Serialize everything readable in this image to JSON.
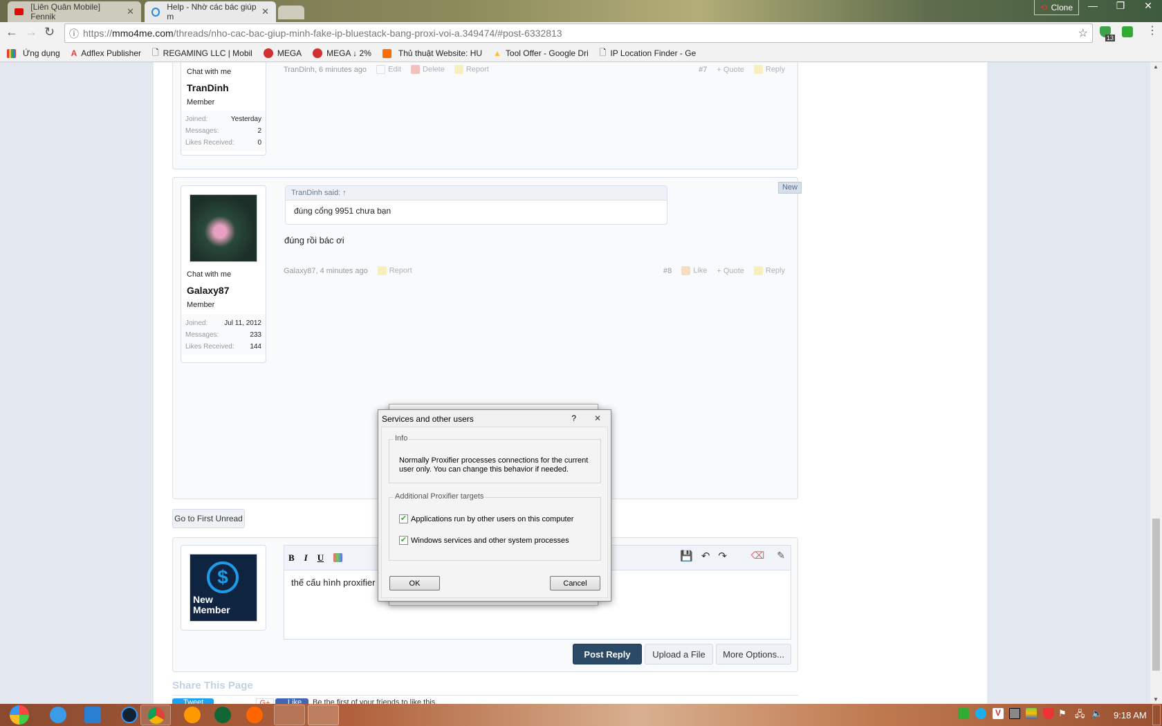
{
  "browser": {
    "tabs": [
      {
        "label": "[Liên Quân Mobile] Fennik",
        "icon": "youtube-icon",
        "active": false
      },
      {
        "label": "Help - Nhờ các bác giúp m",
        "icon": "site-dollar-icon",
        "active": true
      }
    ],
    "profile_label": "Clone",
    "url_host": "mmo4me.com",
    "url_scheme": "https://",
    "url_path": "/threads/nho-cac-bac-giup-minh-fake-ip-bluestack-bang-proxi-voi-a.349474/#post-6332813",
    "extension_badge": "13",
    "bookmarks": [
      {
        "label": "Ứng dụng",
        "color": "#e53935"
      },
      {
        "label": "Adflex Publisher",
        "color": "#e53935"
      },
      {
        "label": "REGAMING LLC | Mobil",
        "color": "#999999"
      },
      {
        "label": "MEGA",
        "color": "#d32f2f"
      },
      {
        "label": "MEGA ↓ 2%",
        "color": "#d32f2f"
      },
      {
        "label": "Thủ thuật Website: HU",
        "color": "#ff6d00"
      },
      {
        "label": "Tool Offer - Google Dri",
        "color": "#2e7d32"
      },
      {
        "label": "IP Location Finder - Ge",
        "color": "#999999"
      }
    ]
  },
  "posts": [
    {
      "chat": "Chat with me",
      "username": "TranDinh",
      "role": "Member",
      "stats": [
        [
          "Joined:",
          "Yesterday"
        ],
        [
          "Messages:",
          "2"
        ],
        [
          "Likes Received:",
          "0"
        ]
      ],
      "author_time": "TranDinh, 6 minutes ago",
      "actions": [
        "Edit",
        "Delete",
        "Report"
      ],
      "number": "#7",
      "right_actions": [
        "+ Quote",
        "Reply"
      ]
    },
    {
      "chat": "Chat with me",
      "username": "Galaxy87",
      "role": "Member",
      "stats": [
        [
          "Joined:",
          "Jul 11, 2012"
        ],
        [
          "Messages:",
          "233"
        ],
        [
          "Likes Received:",
          "144"
        ]
      ],
      "quote_header": "TranDinh said: ↑",
      "quote_text": "đúng cổng 9951 chưa bạn",
      "message": "đúng rồi bác ơi",
      "author_time": "Galaxy87, 4 minutes ago",
      "actions": [
        "Report"
      ],
      "number": "#8",
      "right_actions": [
        "Like",
        "+ Quote",
        "Reply"
      ],
      "badge": "New"
    }
  ],
  "go_first_unread": "Go to First Unread",
  "reply": {
    "avatar_text_1": "New",
    "avatar_text_2": "Member",
    "editor_text": "thế cấu hình proxifier",
    "toolbar": [
      "B",
      "I",
      "U"
    ],
    "post_reply": "Post Reply",
    "upload": "Upload a File",
    "more": "More Options..."
  },
  "share": {
    "title": "Share This Page",
    "tweet": "Tweet",
    "like": "Like",
    "like_text": "Be the first of your friends to like this."
  },
  "dialog": {
    "title": "Services and other users",
    "info_label": "Info",
    "info_text": "Normally Proxifier processes connections for the current user only. You can change this behavior if needed.",
    "targets_label": "Additional Proxifier targets",
    "options": [
      {
        "label": "Applications run by other users on this computer",
        "checked": true
      },
      {
        "label": "Windows services and other system processes",
        "checked": true
      }
    ],
    "ok": "OK",
    "cancel": "Cancel"
  },
  "taskbar": {
    "clock": "9:18 AM"
  }
}
